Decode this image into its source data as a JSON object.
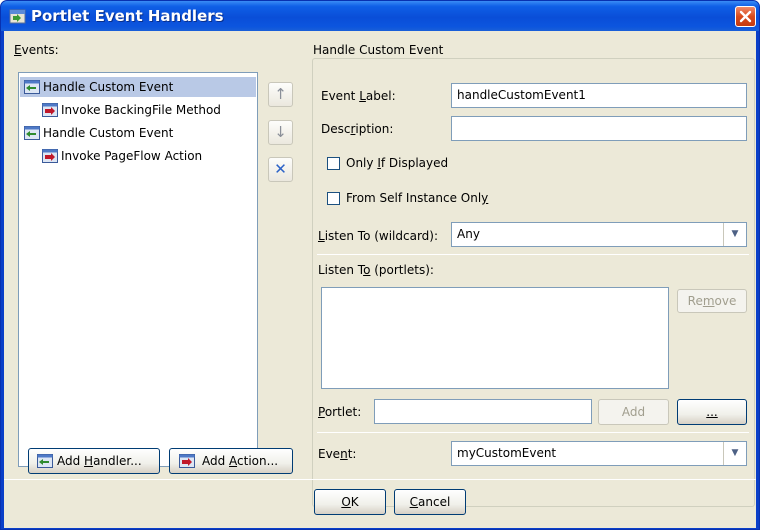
{
  "window": {
    "title": "Portlet Event Handlers"
  },
  "events": {
    "label_prefix": "",
    "label_u": "E",
    "label_rest": "vents:",
    "tree": [
      {
        "label": "Handle Custom Event",
        "level": 0,
        "selected": true,
        "icon": "event-handler-icon"
      },
      {
        "label": "Invoke BackingFile Method",
        "level": 1,
        "selected": false,
        "icon": "action-icon"
      },
      {
        "label": "Handle Custom Event",
        "level": 0,
        "selected": false,
        "icon": "event-handler-icon"
      },
      {
        "label": "Invoke PageFlow Action",
        "level": 1,
        "selected": false,
        "icon": "action-icon"
      }
    ],
    "move_up": "↑",
    "move_down": "↓",
    "remove": "✕",
    "add_handler": {
      "pre": "Add ",
      "u": "H",
      "post": "andler..."
    },
    "add_action": {
      "pre": "Add ",
      "u": "A",
      "post": "ction..."
    }
  },
  "details": {
    "group_title": "Handle Custom Event",
    "event_label": {
      "pre": "Event ",
      "u": "L",
      "post": "abel:",
      "value": "handleCustomEvent1"
    },
    "description": {
      "pre": "Desc",
      "u": "r",
      "post": "iption:",
      "value": ""
    },
    "only_if_displayed": {
      "pre": "Only ",
      "u": "I",
      "post": "f Displayed",
      "checked": false
    },
    "from_self_instance": {
      "pre": "From Self Instance Onl",
      "u": "y",
      "post": "",
      "checked": false
    },
    "listen_to_wildcard": {
      "pre": "",
      "u": "L",
      "post": "isten To (wildcard):",
      "value": "Any"
    },
    "listen_to_portlets": {
      "pre": "Listen T",
      "u": "o",
      "post": " (portlets):"
    },
    "remove_button": {
      "pre": "Re",
      "u": "m",
      "post": "ove"
    },
    "portlet": {
      "pre": "",
      "u": "P",
      "post": "ortlet:",
      "value": ""
    },
    "add_button": "Add",
    "browse_button": {
      "pre": "",
      "u": "...",
      "post": ""
    },
    "event": {
      "pre": "Eve",
      "u": "n",
      "post": "t:",
      "value": "myCustomEvent"
    }
  },
  "footer": {
    "ok": {
      "pre": "",
      "u": "O",
      "post": "K"
    },
    "cancel": {
      "pre": "",
      "u": "C",
      "post": "ancel"
    }
  },
  "colors": {
    "selection": "#b9c9e6",
    "dialog_bg": "#ece9d8",
    "title_bar": "#0a4ed8"
  }
}
